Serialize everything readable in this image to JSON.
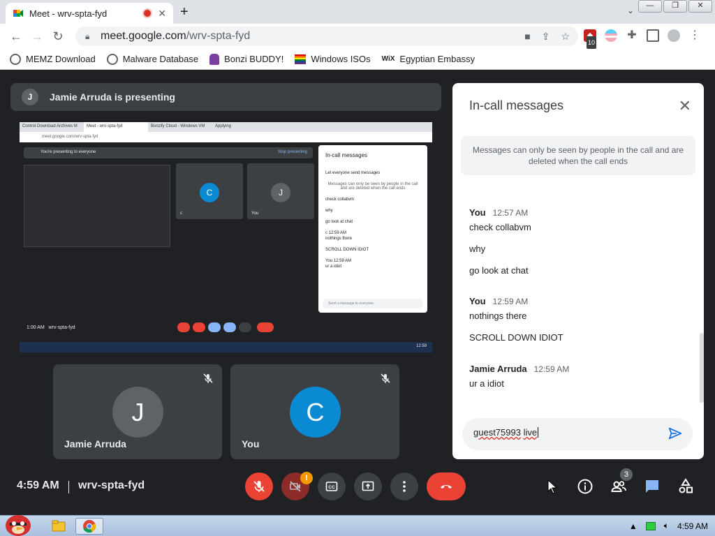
{
  "browser": {
    "tab_title": "Meet - wrv-spta-fyd",
    "url_host": "meet.google.com",
    "url_path": "/wrv-spta-fyd",
    "ext_badge": "10"
  },
  "bookmarks": [
    {
      "label": "MEMZ Download",
      "icon": "globe-icon"
    },
    {
      "label": "Malware Database",
      "icon": "globe-icon"
    },
    {
      "label": "Bonzi BUDDY!",
      "icon": "bonzi-icon"
    },
    {
      "label": "Windows ISOs",
      "icon": "rainbow-flag-icon"
    },
    {
      "label": "Egyptian Embassy",
      "icon": "wix-icon"
    }
  ],
  "meet": {
    "presenter_initial": "J",
    "presenting_text": "Jamie Arruda is presenting",
    "clock": "4:59 AM",
    "meeting_id": "wrv-spta-fyd",
    "people_count": "3",
    "camera_warning": "!"
  },
  "shared_screen": {
    "tabs": [
      "Control Download Archives M",
      "Meet - wrv-spta-fyd",
      "Bonzify Cloud - Windows VM",
      "Applying"
    ],
    "url": "meet.google.com/wrv-spta-fyd",
    "presenting_banner": "You're presenting to everyone",
    "stop_label": "Stop presenting",
    "tiles": [
      {
        "initial": "C",
        "name": "c"
      },
      {
        "initial": "J",
        "name": "You"
      }
    ],
    "chat_title": "In-call messages",
    "chat_toggle": "Let everyone send messages",
    "chat_notice": "Messages can only be seen by people in the call and are deleted when the call ends",
    "chat_lines": [
      "check collabvm",
      "why",
      "go look at chat",
      "c 12:59 AM",
      "nothings there",
      "SCROLL DOWN IDIOT",
      "You 12:59 AM",
      "ur a idiot"
    ],
    "chat_placeholder": "Send a message to everyone",
    "clock": "1:00 AM",
    "meeting_id": "wrv-spta-fyd",
    "taskbar_time": "12:59"
  },
  "tiles": [
    {
      "initial": "J",
      "name": "Jamie Arruda",
      "color": "#5f6368"
    },
    {
      "initial": "C",
      "name": "You",
      "color": "#0b8ad4"
    }
  ],
  "chat": {
    "title": "In-call messages",
    "notice": "Messages can only be seen by people in the call and are deleted when the call ends",
    "groups": [
      {
        "sender": "You",
        "time": "12:57 AM",
        "lines": [
          "check collabvm",
          "why",
          "go look at chat"
        ]
      },
      {
        "sender": "You",
        "time": "12:59 AM",
        "lines": [
          "nothings there",
          "SCROLL DOWN IDIOT"
        ]
      },
      {
        "sender": "Jamie Arruda",
        "time": "12:59 AM",
        "lines": [
          "ur a idiot"
        ]
      }
    ],
    "input_word1": "guest75993",
    "input_word2": "live"
  },
  "taskbar": {
    "time": "4:59 AM"
  }
}
